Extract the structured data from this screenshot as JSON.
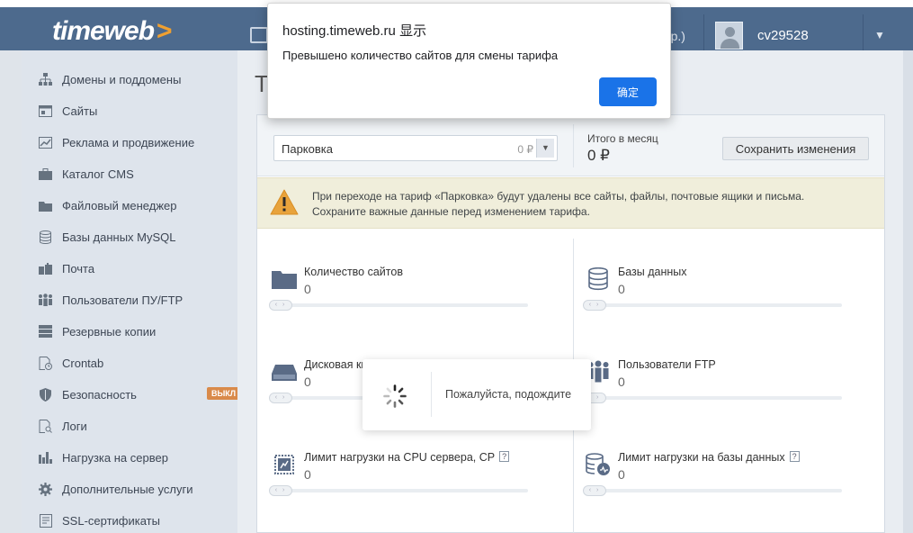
{
  "header": {
    "logo_text": "timeweb",
    "logo_arrow": ">",
    "truncated_text": "пр.)",
    "username": "cv29528",
    "caret": "▼"
  },
  "sidebar": {
    "items": [
      {
        "label": "Домены и поддомены",
        "icon": "sitemap-icon"
      },
      {
        "label": "Сайты",
        "icon": "browser-window-icon"
      },
      {
        "label": "Реклама и продвижение",
        "icon": "chart-line-icon"
      },
      {
        "label": "Каталог CMS",
        "icon": "briefcase-icon"
      },
      {
        "label": "Файловый менеджер",
        "icon": "folder-icon"
      },
      {
        "label": "Базы данных MySQL",
        "icon": "database-icon"
      },
      {
        "label": "Почта",
        "icon": "mailbox-icon"
      },
      {
        "label": "Пользователи ПУ/FTP",
        "icon": "users-icon"
      },
      {
        "label": "Резервные копии",
        "icon": "server-icon"
      },
      {
        "label": "Crontab",
        "icon": "clock-doc-icon"
      },
      {
        "label": "Безопасность",
        "icon": "shield-icon",
        "badge": "ВЫКЛ"
      },
      {
        "label": "Логи",
        "icon": "log-search-icon"
      },
      {
        "label": "Нагрузка на сервер",
        "icon": "bar-chart-icon"
      },
      {
        "label": "Дополнительные услуги",
        "icon": "gear-icon"
      },
      {
        "label": "SSL-сертификаты",
        "icon": "certificate-icon"
      }
    ]
  },
  "main": {
    "title_stub": "Та",
    "tariff": {
      "name": "Парковка",
      "price": "0 ₽"
    },
    "total_label": "Итого в месяц",
    "total_value": "0 ₽",
    "save_label": "Сохранить изменения",
    "warning": {
      "line1": "При переходе на тариф «Парковка» будут удалены все сайты, файлы, почтовые ящики и письма.",
      "line2": "Сохраните важные данные перед изменением тарифа."
    },
    "metrics": [
      {
        "title": "Количество сайтов",
        "value": "0",
        "icon": "folder-icon"
      },
      {
        "title": "Базы данных",
        "value": "0",
        "icon": "database-icon"
      },
      {
        "title": "Дисковая квота, ГБ",
        "value": "0",
        "icon": "hard-drive-icon"
      },
      {
        "title": "Пользователи FTP",
        "value": "0",
        "icon": "users-icon"
      },
      {
        "title": "Лимит нагрузки на CPU сервера, CP",
        "value": "0",
        "icon": "cpu-icon",
        "help": "?"
      },
      {
        "title": "Лимит нагрузки на базы данных",
        "value": "0",
        "icon": "database-load-icon",
        "help": "?"
      }
    ],
    "slider_handle_text": "‹ ›"
  },
  "loading": {
    "text": "Пожалуйста, подождите"
  },
  "alert": {
    "title": "hosting.timeweb.ru 显示",
    "message": "Превышено количество сайтов для смены тарифа",
    "ok_label": "确定"
  },
  "colors": {
    "header_bg": "#4d6a8d",
    "accent_orange": "#f0a030",
    "badge_off": "#d98a4a",
    "alert_button": "#1a73e8",
    "warning_bg": "#f0eedb"
  }
}
